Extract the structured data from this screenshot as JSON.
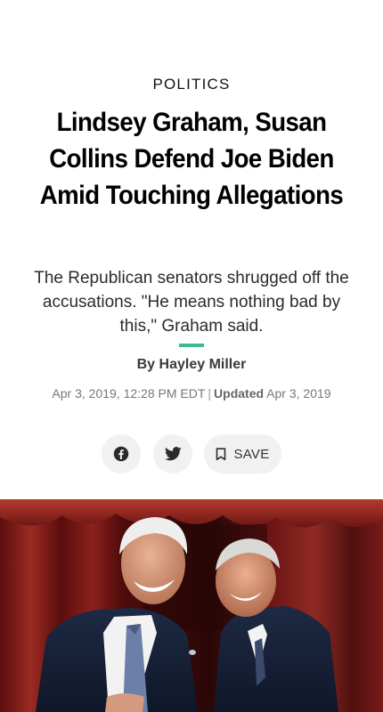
{
  "article": {
    "section": "POLITICS",
    "headline": "Lindsey Graham, Susan Collins Defend Joe Biden Amid Touching Allegations",
    "subhead": "The Republican senators shrugged off the accusations. \"He means nothing bad by this,\" Graham said.",
    "byline": "By Hayley Miller",
    "published": "Apr 3, 2019, 12:28 PM EDT",
    "separator": "|",
    "updated_label": "Updated",
    "updated_date": "Apr 3, 2019"
  },
  "share": {
    "facebook_icon": "facebook-icon",
    "twitter_icon": "twitter-icon",
    "bookmark_icon": "bookmark-icon",
    "save_label": "SAVE"
  },
  "colors": {
    "accent": "#3fb993",
    "share_button_bg": "#f1f1f1",
    "curtain": "#7a1616"
  }
}
